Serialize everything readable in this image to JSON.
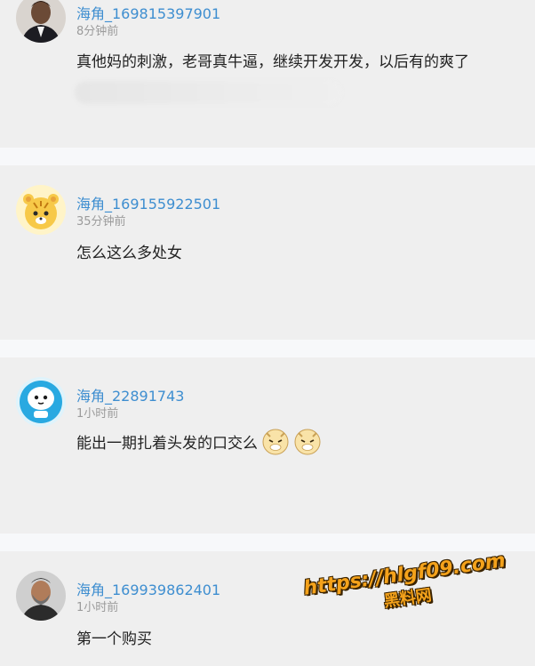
{
  "comments": [
    {
      "username": "海角_169815397901",
      "time": "8分钟前",
      "text": "真他妈的刺激，老哥真牛逼，继续开发开发，以后有的爽了",
      "avatar": "man-in-suit-avatar"
    },
    {
      "username": "海角_169155922501",
      "time": "35分钟前",
      "text": "怎么这么多处女",
      "avatar": "cartoon-tiger-avatar"
    },
    {
      "username": "海角_22891743",
      "time": "1小时前",
      "text": "能出一期扎着头发的口交么",
      "avatar": "blue-mascot-avatar",
      "emojis": [
        "squint-tiger-emoji",
        "squint-tiger-emoji"
      ]
    },
    {
      "username": "海角_169939862401",
      "time": "1小时前",
      "text": "第一个购买",
      "avatar": "bearded-man-avatar"
    }
  ],
  "watermark": {
    "url": "https://hlgf09.com",
    "name": "黑料网"
  },
  "colors": {
    "username": "#3e8ed0",
    "time": "#9b9b9b",
    "text": "#222222",
    "card_bg": "#efefef",
    "page_bg": "#f7f8fa",
    "watermark": "#f4a21b"
  }
}
